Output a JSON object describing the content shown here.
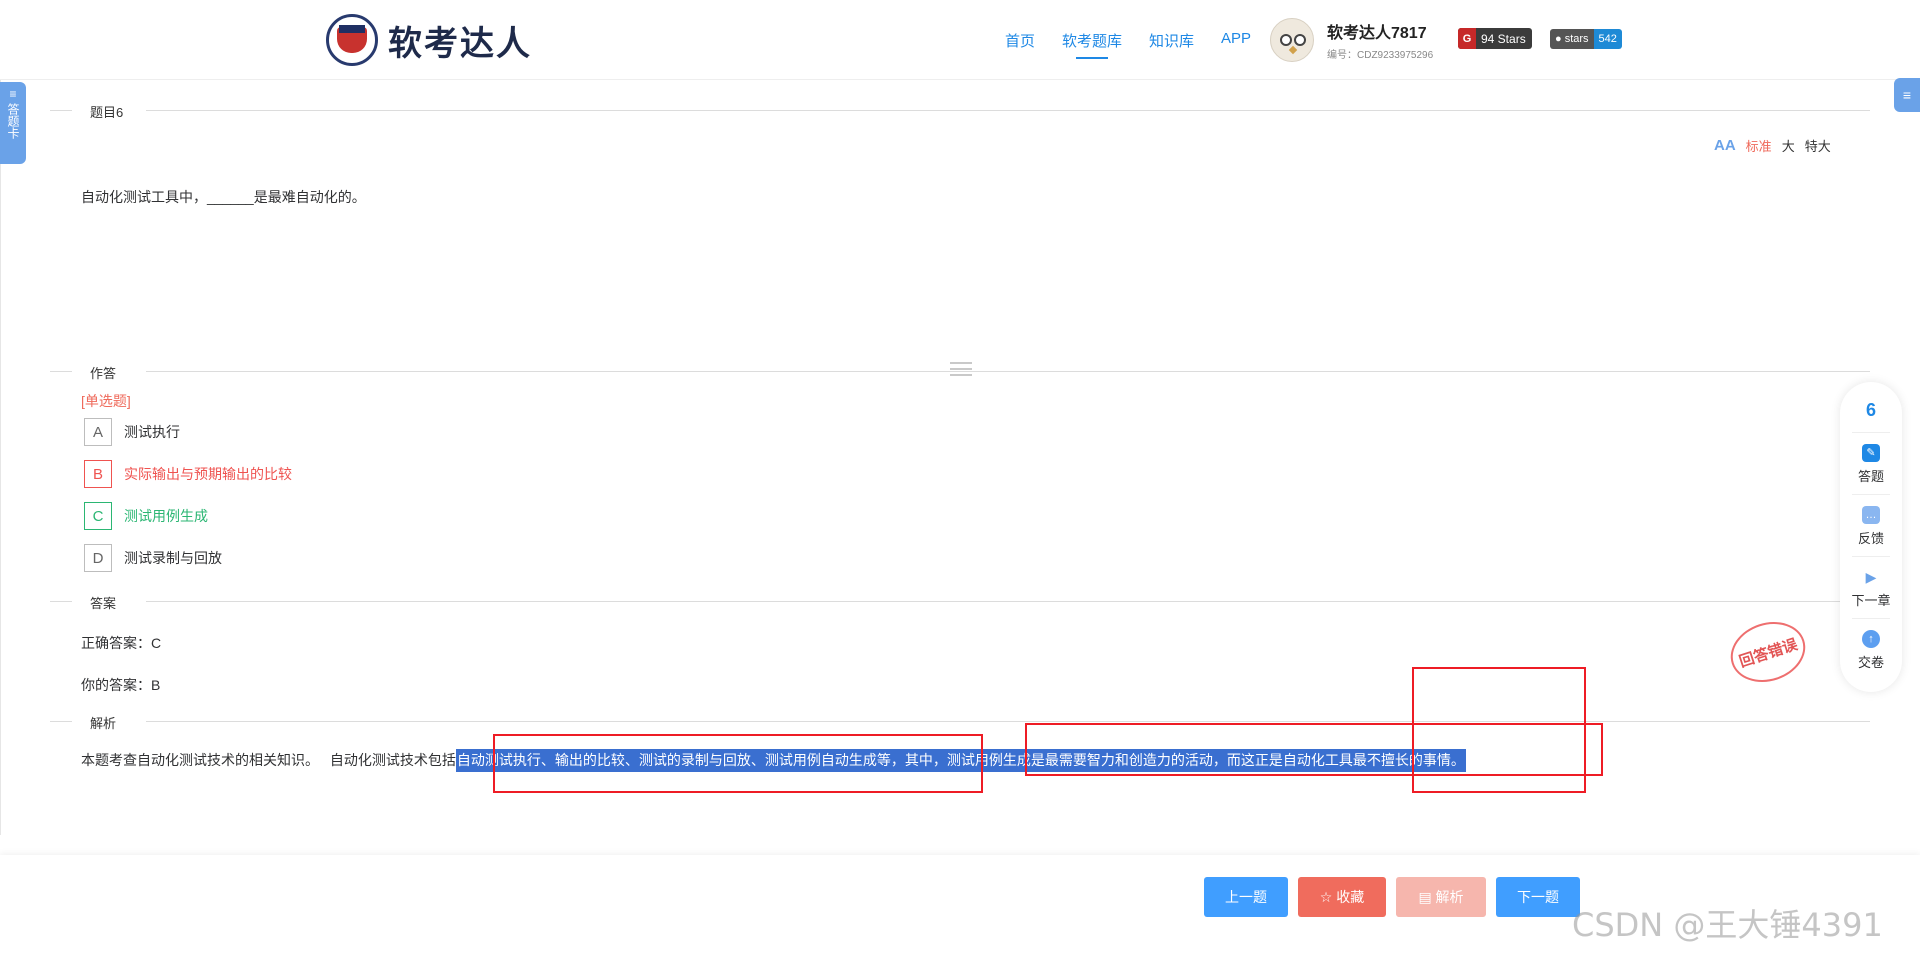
{
  "header": {
    "logo_text": "软考达人",
    "nav": [
      "首页",
      "软考题库",
      "知识库",
      "APP"
    ],
    "user_name": "软考达人7817",
    "user_id": "编号：CDZ9233975296",
    "gitee_badge": "94 Stars",
    "github_label": "stars",
    "github_count": "542"
  },
  "side_left": "答题卡",
  "side_right": "≡",
  "section_question": "题目6",
  "font_size": {
    "normal": "标准",
    "large": "大",
    "xlarge": "特大"
  },
  "question_text": "自动化测试工具中，______是最难自动化的。",
  "section_answer_area": "作答",
  "question_type": "[单选题]",
  "options": [
    {
      "letter": "A",
      "text": "测试执行"
    },
    {
      "letter": "B",
      "text": "实际输出与预期输出的比较"
    },
    {
      "letter": "C",
      "text": "测试用例生成"
    },
    {
      "letter": "D",
      "text": "测试录制与回放"
    }
  ],
  "section_answer": "答案",
  "correct_answer": "正确答案：C",
  "your_answer": "你的答案：B",
  "section_analysis": "解析",
  "analysis": {
    "part1": "本题考查自动化测试技术的相关知识。　 自动化测试技术包括",
    "part2": "自动测试执行、输出的比较、测试的录制与回放、测试用例自动生成等，其中，测试用例生成是最需要智力和创造力的活动，而这正是自动化工具最不擅长的事情。"
  },
  "stamp_text": "回答错误",
  "float_panel": {
    "current": "6",
    "answer": "答题",
    "feedback": "反馈",
    "next_chapter": "下一章",
    "submit": "交卷"
  },
  "buttons": {
    "prev": "上一题",
    "favorite": "☆ 收藏",
    "analysis": "▤ 解析",
    "next": "下一题"
  },
  "watermark": "CSDN @王大锤4391",
  "colors": {
    "primary": "#409eff",
    "danger": "#ef5350",
    "success": "#2bb673",
    "highlight": "#3a6fd0"
  }
}
